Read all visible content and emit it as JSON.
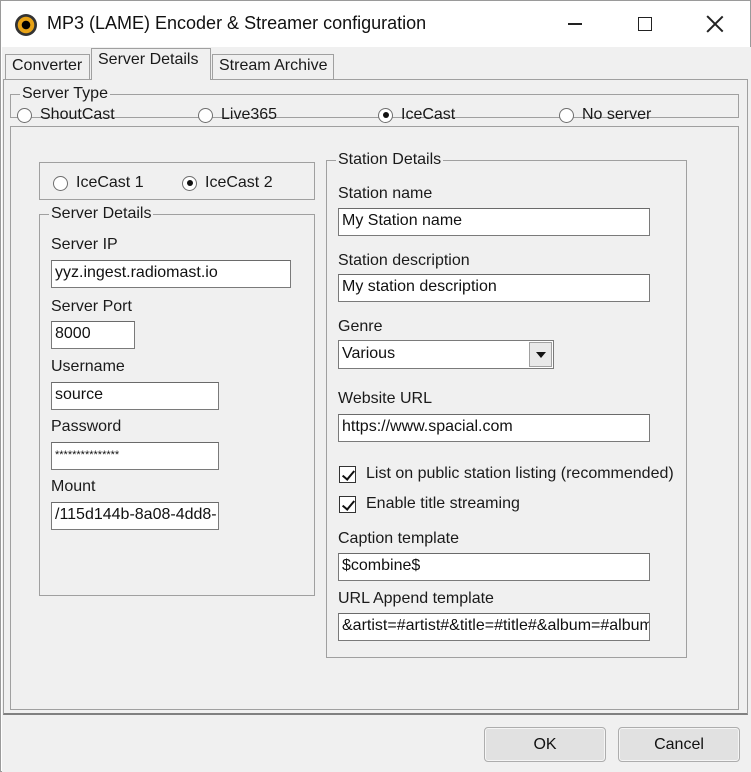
{
  "window": {
    "title": "MP3 (LAME) Encoder & Streamer configuration",
    "icon": "mp3-encoder-icon"
  },
  "tabs": [
    {
      "label": "Converter",
      "active": false
    },
    {
      "label": "Server Details",
      "active": true
    },
    {
      "label": "Stream Archive",
      "active": false
    }
  ],
  "server_type": {
    "legend": "Server Type",
    "options": [
      {
        "label": "ShoutCast",
        "selected": false
      },
      {
        "label": "Live365",
        "selected": false
      },
      {
        "label": "IceCast",
        "selected": true
      },
      {
        "label": "No server",
        "selected": false
      }
    ]
  },
  "icecast_version": {
    "options": [
      {
        "label": "IceCast 1",
        "selected": false
      },
      {
        "label": "IceCast 2",
        "selected": true
      }
    ]
  },
  "server_details": {
    "legend": "Server Details",
    "server_ip_label": "Server IP",
    "server_ip": "yyz.ingest.radiomast.io",
    "server_port_label": "Server Port",
    "server_port": "8000",
    "username_label": "Username",
    "username": "source",
    "password_label": "Password",
    "password": "***************",
    "mount_label": "Mount",
    "mount": "/115d144b-8a08-4dd8-"
  },
  "station_details": {
    "legend": "Station Details",
    "name_label": "Station name",
    "name": "My Station name",
    "description_label": "Station description",
    "description": "My station description",
    "genre_label": "Genre",
    "genre": "Various",
    "website_label": "Website URL",
    "website": "https://www.spacial.com",
    "list_public_label": "List on public station listing (recommended)",
    "list_public_checked": true,
    "title_streaming_label": "Enable title streaming",
    "title_streaming_checked": true,
    "caption_label": "Caption template",
    "caption": "$combine$",
    "url_append_label": "URL Append template",
    "url_append": "&artist=#artist#&title=#title#&album=#album#"
  },
  "buttons": {
    "ok": "OK",
    "cancel": "Cancel"
  }
}
